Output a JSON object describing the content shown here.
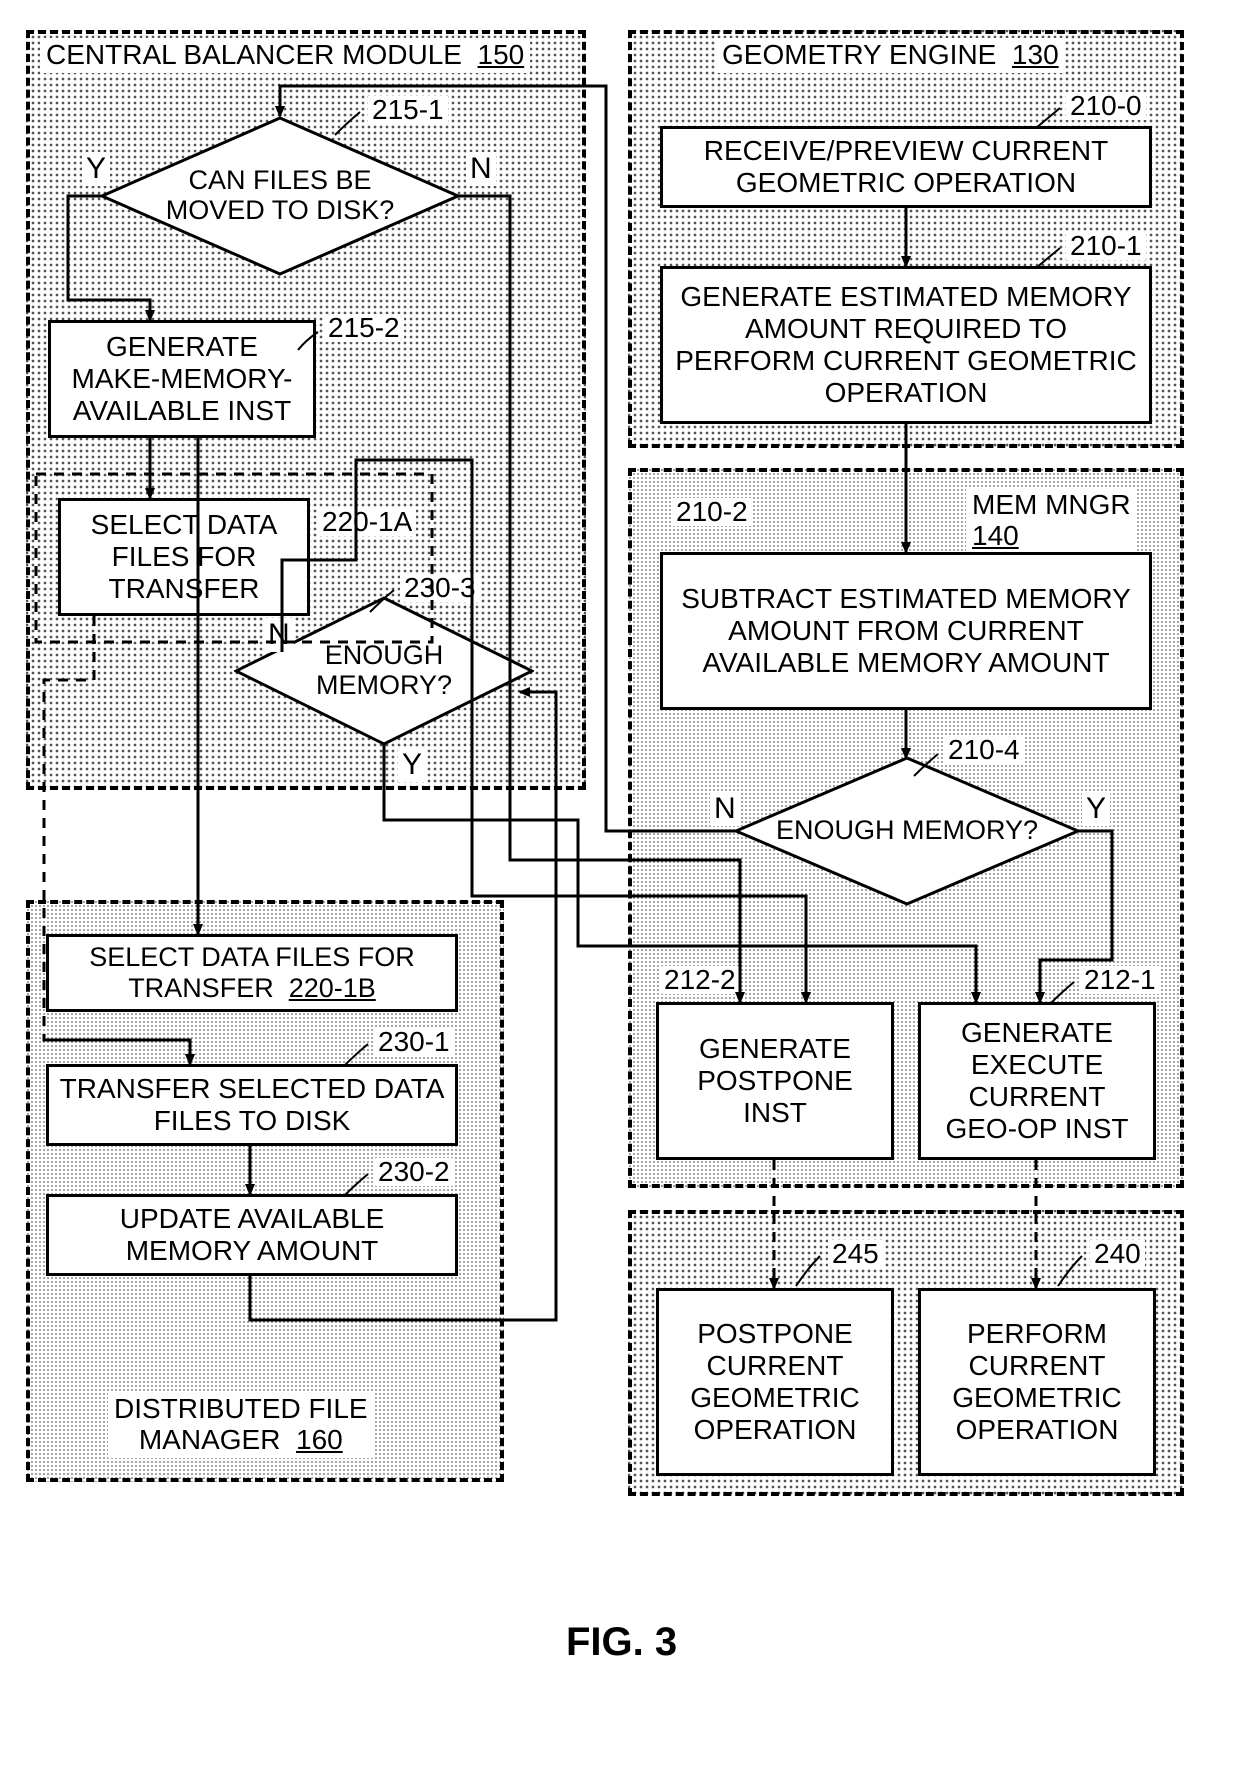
{
  "figure_label": "FIG. 3",
  "modules": {
    "central_balancer": {
      "title": "CENTRAL BALANCER MODULE",
      "num": "150"
    },
    "geometry_engine": {
      "title": "GEOMETRY ENGINE",
      "num": "130"
    },
    "mem_mngr": {
      "title": "MEM MNGR",
      "num": "140"
    },
    "dfm": {
      "title": "DISTRIBUTED FILE MANAGER",
      "num": "160"
    }
  },
  "nodes": {
    "n215_1": {
      "text": "CAN FILES BE MOVED TO DISK?",
      "ref": "215-1"
    },
    "n215_2": {
      "text": "GENERATE MAKE-MEMORY-AVAILABLE INST",
      "ref": "215-2"
    },
    "n220_1A": {
      "text": "SELECT DATA FILES FOR TRANSFER",
      "ref": "220-1A"
    },
    "n230_3": {
      "text": "ENOUGH MEMORY?",
      "ref": "230-3"
    },
    "n220_1B": {
      "text": "SELECT DATA FILES FOR TRANSFER",
      "ref": "220-1B"
    },
    "n230_1": {
      "text": "TRANSFER SELECTED DATA FILES TO DISK",
      "ref": "230-1"
    },
    "n230_2": {
      "text": "UPDATE AVAILABLE MEMORY AMOUNT",
      "ref": "230-2"
    },
    "n210_0": {
      "text": "RECEIVE/PREVIEW CURRENT GEOMETRIC OPERATION",
      "ref": "210-0"
    },
    "n210_1": {
      "text": "GENERATE ESTIMATED MEMORY AMOUNT REQUIRED TO PERFORM CURRENT GEOMETRIC OPERATION",
      "ref": "210-1"
    },
    "n210_2": {
      "text": "SUBTRACT ESTIMATED MEMORY AMOUNT FROM CURRENT AVAILABLE MEMORY AMOUNT",
      "ref": "210-2"
    },
    "n210_4": {
      "text": "ENOUGH MEMORY?",
      "ref": "210-4"
    },
    "n212_2": {
      "text": "GENERATE POSTPONE INST",
      "ref": "212-2"
    },
    "n212_1": {
      "text": "GENERATE EXECUTE CURRENT GEO-OP INST",
      "ref": "212-1"
    },
    "n245": {
      "text": "POSTPONE CURRENT GEOMETRIC OPERATION",
      "ref": "245"
    },
    "n240": {
      "text": "PERFORM CURRENT GEOMETRIC OPERATION",
      "ref": "240"
    }
  },
  "yn": {
    "Y": "Y",
    "N": "N"
  },
  "chart_data": {
    "type": "diagram",
    "title": "FIG. 3",
    "modules": [
      {
        "id": "150",
        "name": "CENTRAL BALANCER MODULE"
      },
      {
        "id": "130",
        "name": "GEOMETRY ENGINE"
      },
      {
        "id": "140",
        "name": "MEM MNGR"
      },
      {
        "id": "160",
        "name": "DISTRIBUTED FILE MANAGER"
      }
    ],
    "nodes": [
      {
        "id": "210-0",
        "module": "130",
        "type": "process",
        "text": "RECEIVE/PREVIEW CURRENT GEOMETRIC OPERATION"
      },
      {
        "id": "210-1",
        "module": "130",
        "type": "process",
        "text": "GENERATE ESTIMATED MEMORY AMOUNT REQUIRED TO PERFORM CURRENT GEOMETRIC OPERATION"
      },
      {
        "id": "210-2",
        "module": "140",
        "type": "process",
        "text": "SUBTRACT ESTIMATED MEMORY AMOUNT FROM CURRENT AVAILABLE MEMORY AMOUNT"
      },
      {
        "id": "210-4",
        "module": "140",
        "type": "decision",
        "text": "ENOUGH MEMORY?"
      },
      {
        "id": "212-1",
        "module": "140",
        "type": "process",
        "text": "GENERATE EXECUTE CURRENT GEO-OP INST"
      },
      {
        "id": "212-2",
        "module": "140",
        "type": "process",
        "text": "GENERATE POSTPONE INST"
      },
      {
        "id": "215-1",
        "module": "150",
        "type": "decision",
        "text": "CAN FILES BE MOVED TO DISK?"
      },
      {
        "id": "215-2",
        "module": "150",
        "type": "process",
        "text": "GENERATE MAKE-MEMORY-AVAILABLE INST"
      },
      {
        "id": "220-1A",
        "module": "150",
        "type": "process",
        "text": "SELECT DATA FILES FOR TRANSFER"
      },
      {
        "id": "230-3",
        "module": "150",
        "type": "decision",
        "text": "ENOUGH MEMORY?"
      },
      {
        "id": "220-1B",
        "module": "160",
        "type": "process",
        "text": "SELECT DATA FILES FOR TRANSFER"
      },
      {
        "id": "230-1",
        "module": "160",
        "type": "process",
        "text": "TRANSFER SELECTED DATA FILES TO DISK"
      },
      {
        "id": "230-2",
        "module": "160",
        "type": "process",
        "text": "UPDATE AVAILABLE MEMORY AMOUNT"
      },
      {
        "id": "245",
        "module": "130",
        "type": "process",
        "text": "POSTPONE CURRENT GEOMETRIC OPERATION"
      },
      {
        "id": "240",
        "module": "130",
        "type": "process",
        "text": "PERFORM CURRENT GEOMETRIC OPERATION"
      }
    ],
    "edges": [
      {
        "from": "210-0",
        "to": "210-1"
      },
      {
        "from": "210-1",
        "to": "210-2"
      },
      {
        "from": "210-2",
        "to": "210-4"
      },
      {
        "from": "210-4",
        "to": "212-1",
        "label": "Y"
      },
      {
        "from": "210-4",
        "to": "215-1",
        "label": "N"
      },
      {
        "from": "215-1",
        "to": "215-2",
        "label": "Y"
      },
      {
        "from": "215-1",
        "to": "212-2",
        "label": "N"
      },
      {
        "from": "215-2",
        "to": "220-1A"
      },
      {
        "from": "215-2",
        "to": "220-1B"
      },
      {
        "from": "220-1A",
        "to": "230-1",
        "style": "dashed"
      },
      {
        "from": "220-1B",
        "to": "230-1",
        "style": "dashed"
      },
      {
        "from": "230-1",
        "to": "230-2"
      },
      {
        "from": "230-2",
        "to": "230-3"
      },
      {
        "from": "230-3",
        "to": "212-1",
        "label": "Y"
      },
      {
        "from": "230-3",
        "to": "212-2",
        "label": "N"
      },
      {
        "from": "212-2",
        "to": "245",
        "style": "dashed"
      },
      {
        "from": "212-1",
        "to": "240",
        "style": "dashed"
      }
    ]
  }
}
